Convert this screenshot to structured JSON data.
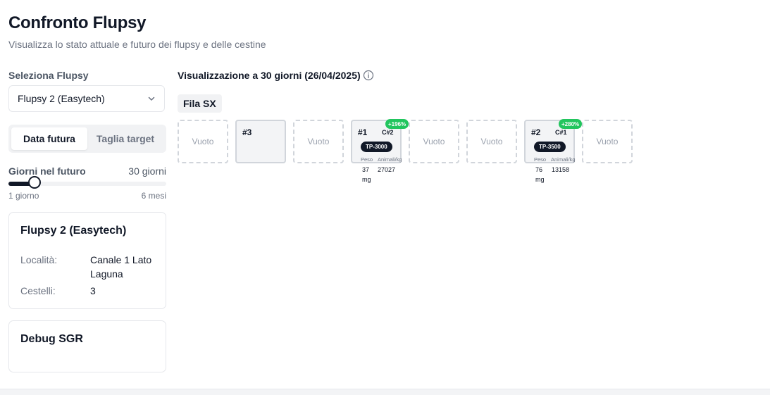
{
  "page": {
    "title": "Confronto Flupsy",
    "subtitle": "Visualizza lo stato attuale e futuro dei flupsy e delle cestine"
  },
  "sidebar": {
    "select_label": "Seleziona Flupsy",
    "select_value": "Flupsy 2 (Easytech)",
    "tabs": [
      {
        "label": "Data futura",
        "active": true
      },
      {
        "label": "Taglia target",
        "active": false
      }
    ],
    "days_label": "Giorni nel futuro",
    "days_value": "30 giorni",
    "slider_min_label": "1 giorno",
    "slider_max_label": "6 mesi",
    "slider_fraction": 0.165,
    "info_card": {
      "title": "Flupsy 2 (Easytech)",
      "location_label": "Località:",
      "location_value": "Canale 1 Lato Laguna",
      "baskets_label": "Cestelli:",
      "baskets_value": "3"
    },
    "debug_card": {
      "title": "Debug SGR"
    }
  },
  "main": {
    "viz_title": "Visualizzazione a 30 giorni (26/04/2025)",
    "row_label": "Fila SX",
    "slots": [
      {
        "type": "empty",
        "label": "Vuoto"
      },
      {
        "type": "plain",
        "number": "#3"
      },
      {
        "type": "empty",
        "label": "Vuoto"
      },
      {
        "type": "filled",
        "number": "#1",
        "code": "C#2",
        "growth": "+196%",
        "size": "TP-3000",
        "peso_label": "Peso",
        "peso_value": "37 mg",
        "animali_label": "Animali/kg",
        "animali_value": "27027"
      },
      {
        "type": "empty",
        "label": "Vuoto"
      },
      {
        "type": "empty",
        "label": "Vuoto"
      },
      {
        "type": "filled",
        "number": "#2",
        "code": "C#1",
        "growth": "+280%",
        "size": "TP-3500",
        "peso_label": "Peso",
        "peso_value": "76 mg",
        "animali_label": "Animali/kg",
        "animali_value": "13158"
      },
      {
        "type": "empty",
        "label": "Vuoto"
      }
    ]
  },
  "colors": {
    "accent_dark": "#111827",
    "growth_green": "#22c55e",
    "muted_text": "#6b7280",
    "border": "#d1d5db"
  }
}
